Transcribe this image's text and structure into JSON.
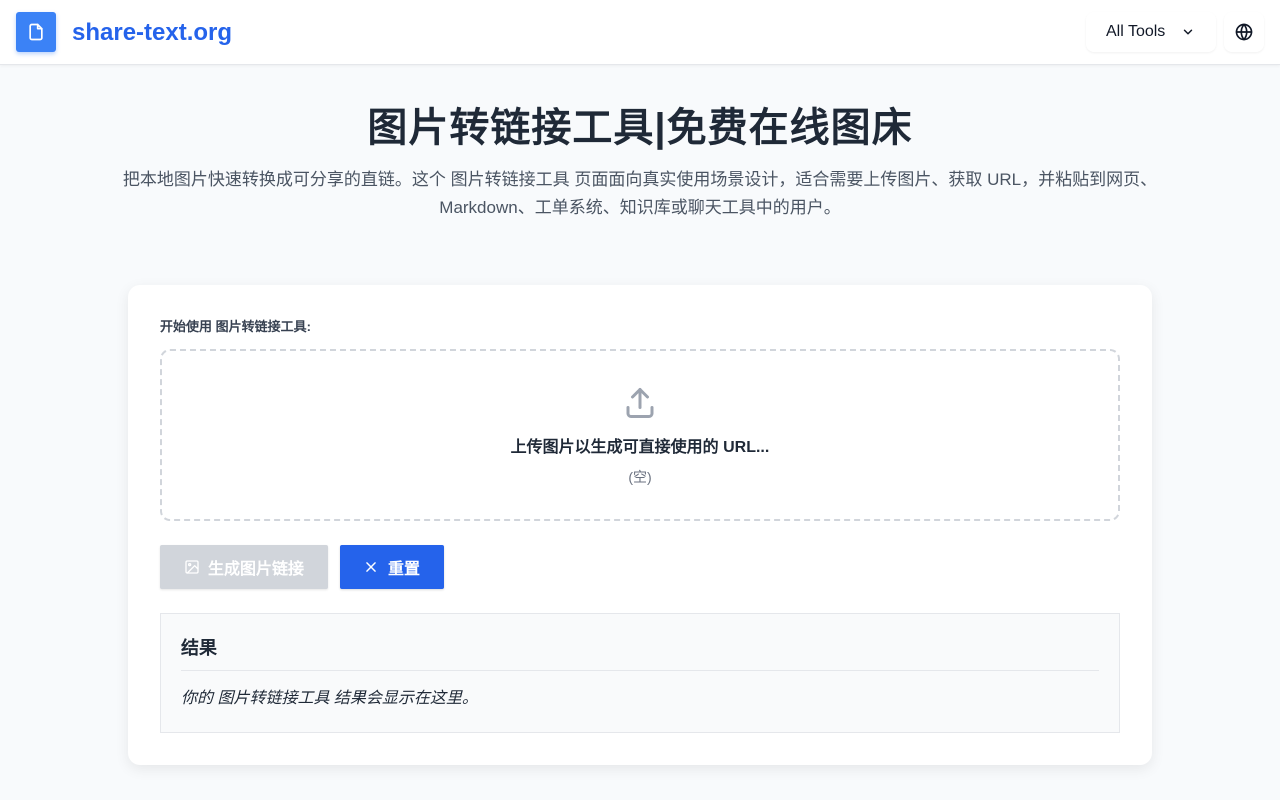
{
  "header": {
    "brand": "share-text.org",
    "tools_label": "All Tools",
    "colors": {
      "brand": "#2563eb",
      "logo_bg": "#3b82f6"
    },
    "icons": {
      "logo": "file-icon",
      "tools": "chevron-down-icon",
      "language": "globe-icon"
    }
  },
  "hero": {
    "title": "图片转链接工具|免费在线图床",
    "description": "把本地图片快速转换成可分享的直链。这个 图片转链接工具 页面面向真实使用场景设计，适合需要上传图片、获取 URL，并粘贴到网页、Markdown、工单系统、知识库或聊天工具中的用户。"
  },
  "card": {
    "label": "开始使用 图片转链接工具:",
    "dropzone": {
      "icon": "upload-icon",
      "text": "上传图片以生成可直接使用的 URL...",
      "subtext": "(空)"
    },
    "buttons": {
      "generate": {
        "label": "生成图片链接",
        "icon": "image-icon",
        "state": "disabled"
      },
      "reset": {
        "label": "重置",
        "icon": "close-icon"
      }
    },
    "result": {
      "title": "结果",
      "placeholder": "你的 图片转链接工具 结果会显示在这里。"
    }
  },
  "colors": {
    "primary": "#2563eb",
    "disabled": "#d1d5db",
    "background": "#f8fafc"
  }
}
